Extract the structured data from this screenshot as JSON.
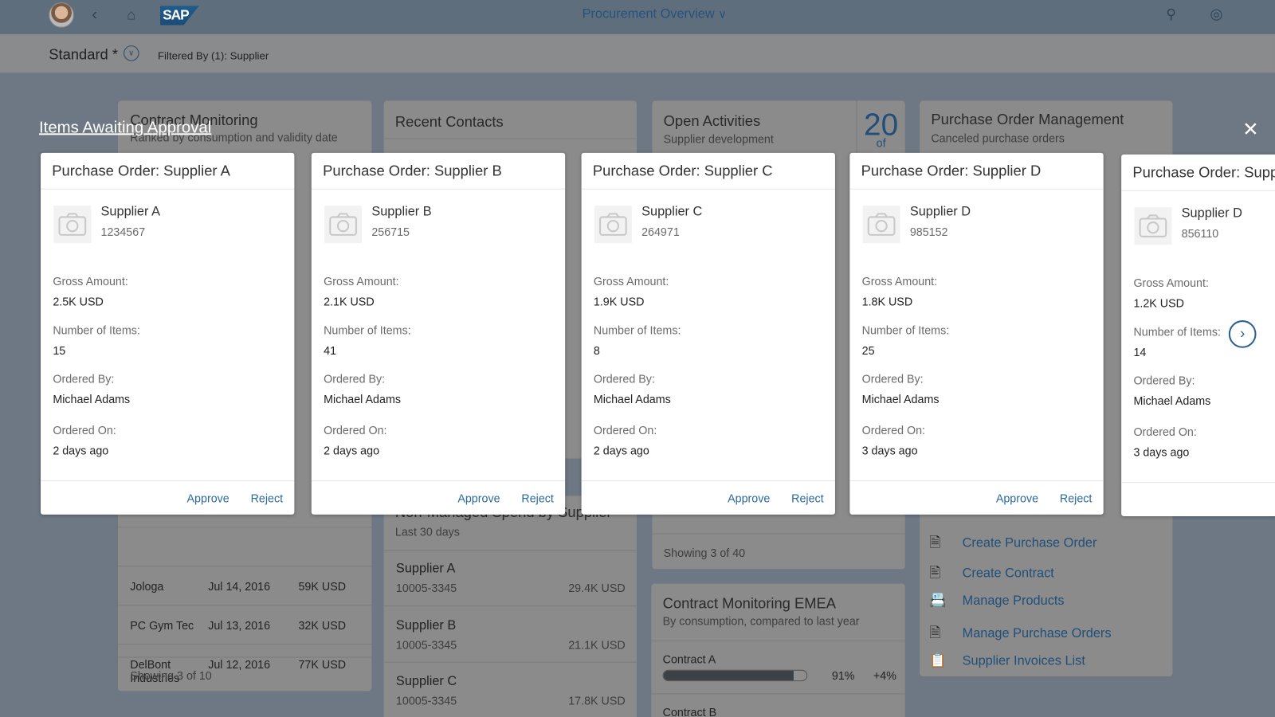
{
  "shell": {
    "title": "Procurement Overview",
    "icons": [
      "avatar",
      "back-icon",
      "home-icon",
      "sap-logo",
      "chevron-down-icon",
      "search-icon",
      "copilot-icon"
    ],
    "logo_text": "SAP"
  },
  "filter": {
    "variant": "Standard *",
    "filtered_by": "Filtered By (1): Supplier"
  },
  "tiles": {
    "contract_monitoring": {
      "title": "Contract Monitoring",
      "subtitle": "Ranked by consumption and validity date",
      "rows": [
        {
          "name": "Jologa",
          "date": "Jul 14, 2016",
          "amount": "59K USD"
        },
        {
          "name": "PC Gym Tec",
          "date": "Jul 13, 2016",
          "amount": "32K USD"
        },
        {
          "name": "DelBont Industries",
          "date": "Jul 12, 2016",
          "amount": "77K USD"
        }
      ],
      "footer": "Showing 3 of 10"
    },
    "recent_contacts": {
      "title": "Recent Contacts"
    },
    "non_managed": {
      "title": "Non-Managed Spend by Supplier",
      "subtitle": "Last 30 days",
      "rows": [
        {
          "name": "Supplier A",
          "id": "10005-3345",
          "amount": "29.4K USD"
        },
        {
          "name": "Supplier B",
          "id": "10005-3345",
          "amount": "21.1K USD"
        },
        {
          "name": "Supplier C",
          "id": "10005-3345",
          "amount": "17.8K USD"
        }
      ]
    },
    "open_activities": {
      "title": "Open Activities",
      "subtitle": "Supplier development",
      "count": "20",
      "count_of": "of",
      "footer": "Showing 3 of 40"
    },
    "po_management": {
      "title": "Purchase Order Management",
      "subtitle": "Canceled purchase orders",
      "links": [
        {
          "label": "Create Purchase Order",
          "icon": "document-dollar-icon"
        },
        {
          "label": "Create Contract",
          "icon": "contract-icon"
        },
        {
          "label": "Manage Products",
          "icon": "product-add-icon"
        },
        {
          "label": "Manage Purchase Orders",
          "icon": "purchase-orders-icon"
        },
        {
          "label": "Supplier Invoices List",
          "icon": "supplier-invoice-icon"
        }
      ]
    },
    "contract_emea": {
      "title": "Contract Monitoring EMEA",
      "subtitle": "By consumption, compared to last year",
      "contracts": [
        {
          "name": "Contract A",
          "percent": 91,
          "percent_label": "91%",
          "delta": "+4%"
        },
        {
          "name": "Contract B"
        }
      ]
    }
  },
  "dialog": {
    "title": "Items Awaiting Approval",
    "labels": {
      "gross": "Gross Amount:",
      "items": "Number of Items:",
      "ordered_by": "Ordered By:",
      "ordered_on": "Ordered On:",
      "approve": "Approve",
      "reject": "Reject"
    },
    "cards": [
      {
        "title": "Purchase Order: Supplier A",
        "supplier": "Supplier A",
        "id": "1234567",
        "gross": "2.5K USD",
        "items": "15",
        "ordered_by": "Michael Adams",
        "ordered_on": "2 days ago"
      },
      {
        "title": "Purchase Order: Supplier B",
        "supplier": "Supplier B",
        "id": "256715",
        "gross": "2.1K USD",
        "items": "41",
        "ordered_by": "Michael Adams",
        "ordered_on": "2 days ago"
      },
      {
        "title": "Purchase Order: Supplier C",
        "supplier": "Supplier C",
        "id": "264971",
        "gross": "1.9K USD",
        "items": "8",
        "ordered_by": "Michael Adams",
        "ordered_on": "2 days ago"
      },
      {
        "title": "Purchase Order: Supplier D",
        "supplier": "Supplier D",
        "id": "985152",
        "gross": "1.8K USD",
        "items": "25",
        "ordered_by": "Michael Adams",
        "ordered_on": "3 days ago"
      },
      {
        "title": "Purchase Order: Supp",
        "supplier": "Supplier D",
        "id": "856110",
        "gross": "1.2K USD",
        "items": "14",
        "ordered_by": "Michael Adams",
        "ordered_on": "3 days ago"
      }
    ]
  },
  "colors": {
    "accent": "#2b6aa1",
    "shell": "#5e6e7c",
    "overlay_bg": "#6d7884"
  }
}
